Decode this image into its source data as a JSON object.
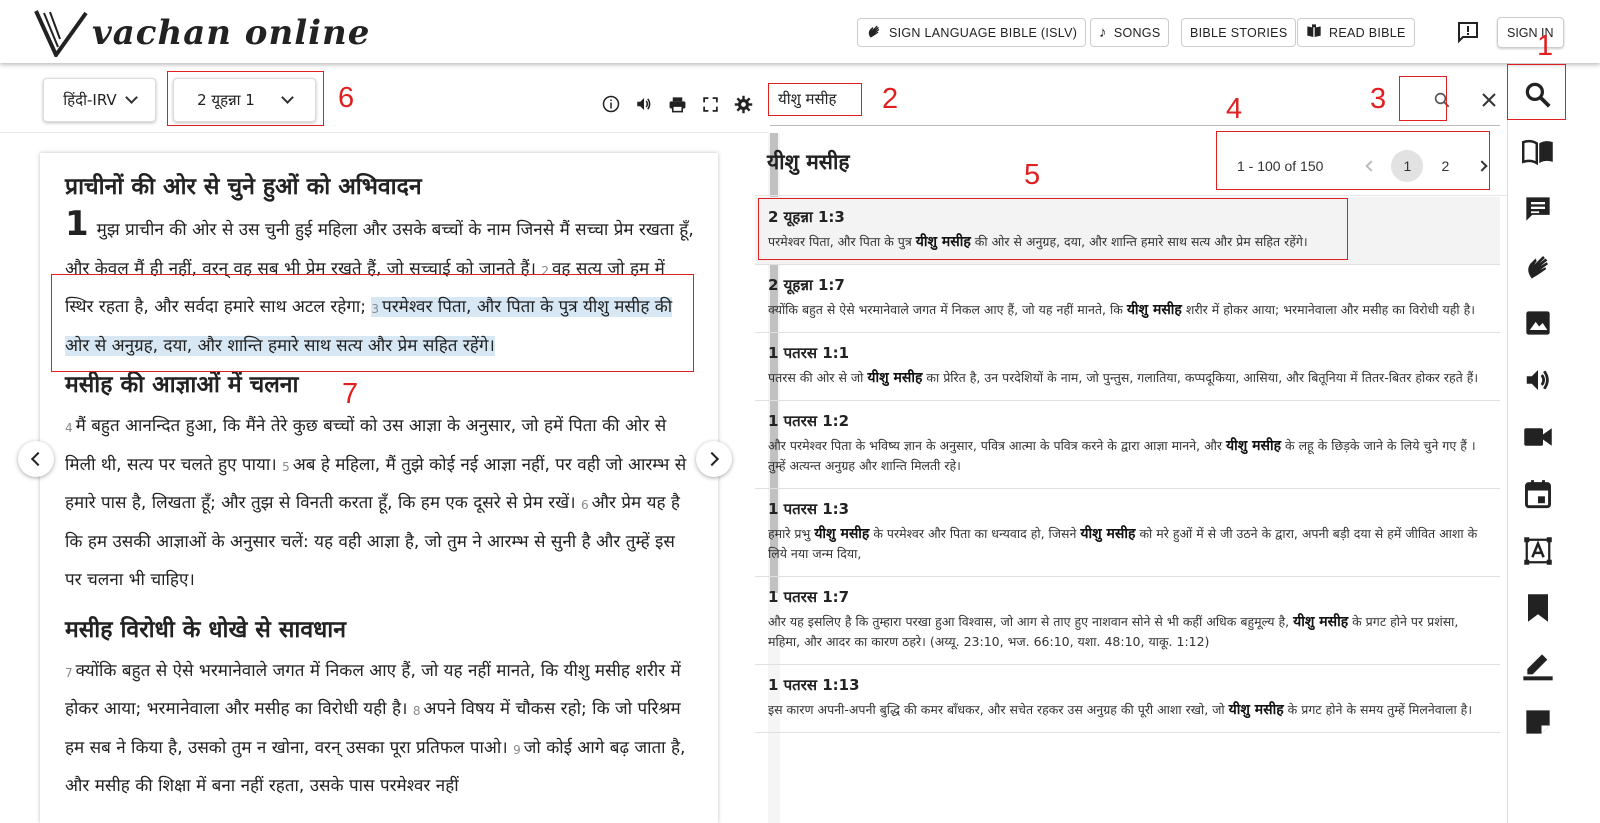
{
  "header": {
    "logo_text": "vachan online",
    "buttons": [
      {
        "label": "SIGN LANGUAGE BIBLE (ISLV)",
        "icon": "sign-language-icon"
      },
      {
        "label": "SONGS",
        "icon": "music-note-icon"
      },
      {
        "label": "BIBLE STORIES"
      },
      {
        "label": "READ BIBLE",
        "icon": "book-open-icon"
      }
    ],
    "feedback_icon": "feedback-icon",
    "sign_in": "SIGN IN"
  },
  "annotations": [
    "1",
    "2",
    "3",
    "4",
    "5",
    "6",
    "7"
  ],
  "reader": {
    "version": "हिंदी-IRV",
    "book_chapter": "2 यूहन्ना 1",
    "tool_icons": [
      "info-icon",
      "volume-icon",
      "print-icon",
      "fullscreen-icon",
      "settings-icon"
    ],
    "sections": [
      {
        "heading": "प्राचीनों की ओर से चुने हुओं को अभिवादन",
        "chapter": "1",
        "v1": "मुझ प्राचीन की ओर से उस चुनी हुई महिला और उसके बच्चों के नाम जिनसे मैं सच्चा प्रेम रखता हूँ, और केवल मैं ही नहीं, वरन् वह सब भी प्रेम रखते हैं, जो सच्चाई को जानते हैं।",
        "n2": "2",
        "v2": "वह सत्य जो हम में स्थिर रहता है, और सर्वदा हमारे साथ अटल रहेगा;",
        "n3": "3",
        "v3": "परमेश्वर पिता, और पिता के पुत्र यीशु मसीह की ओर से अनुग्रह, दया, और शान्ति हमारे साथ सत्य और प्रेम सहित रहेंगे।"
      },
      {
        "heading": "मसीह की आज्ञाओं में चलना",
        "n4": "4",
        "v4": "मैं बहुत आनन्दित हुआ, कि मैंने तेरे कुछ बच्चों को उस आज्ञा के अनुसार, जो हमें पिता की ओर से मिली थी, सत्य पर चलते हुए पाया।",
        "n5": "5",
        "v5": "अब हे महिला, मैं तुझे कोई नई आज्ञा नहीं, पर वही जो आरम्भ से हमारे पास है, लिखता हूँ; और तुझ से विनती करता हूँ, कि हम एक दूसरे से प्रेम रखें।",
        "n6": "6",
        "v6": "और प्रेम यह है कि हम उसकी आज्ञाओं के अनुसार चलें: यह वही आज्ञा है, जो तुम ने आरम्भ से सुनी है और तुम्हें इस पर चलना भी चाहिए।"
      },
      {
        "heading": "मसीह विरोधी के धोखे से सावधान",
        "n7": "7",
        "v7": "क्योंकि बहुत से ऐसे भरमानेवाले जगत में निकल आए हैं, जो यह नहीं मानते, कि यीशु मसीह शरीर में होकर आया; भरमानेवाला और मसीह का विरोधी यही है।",
        "n8": "8",
        "v8": "अपने विषय में चौकस रहो; कि जो परिश्रम हम सब ने किया है, उसको तुम न खोना, वरन् उसका पूरा प्रतिफल पाओ।",
        "n9": "9",
        "v9": "जो कोई आगे बढ़ जाता है, और मसीह की शिक्षा में बना नहीं रहता, उसके पास परमेश्वर नहीं"
      }
    ]
  },
  "search": {
    "query": "यीशु मसीह",
    "result_title": "यीशु मसीह",
    "range": "1 - 100 of 150",
    "pages": [
      "1",
      "2"
    ],
    "results": [
      {
        "ref": "2 यूहन्ना 1:3",
        "pre": "परमेश्वर पिता, और पिता के पुत्र ",
        "hit": "यीशु मसीह",
        "post": " की ओर से अनुग्रह, दया, और शान्ति हमारे साथ सत्य और प्रेम सहित रहेंगे।",
        "hit2": "",
        "post2": ""
      },
      {
        "ref": "2 यूहन्ना 1:7",
        "pre": "क्योंकि बहुत से ऐसे भरमानेवाले जगत में निकल आए हैं, जो यह नहीं मानते, कि ",
        "hit": "यीशु मसीह",
        "post": " शरीर में होकर आया; भरमानेवाला और मसीह का विरोधी यही है।",
        "hit2": "",
        "post2": ""
      },
      {
        "ref": "1 पतरस 1:1",
        "pre": "पतरस की ओर से जो ",
        "hit": "यीशु मसीह",
        "post": " का प्रेरित है, उन परदेशियों के नाम, जो पुन्तुस, गलातिया, कप्पदूकिया, आसिया, और बितूनिया में तितर-बितर होकर रहते हैं।",
        "hit2": "",
        "post2": ""
      },
      {
        "ref": "1 पतरस 1:2",
        "pre": "और परमेश्वर पिता के भविष्य ज्ञान के अनुसार, पवित्र आत्मा के पवित्र करने के द्वारा आज्ञा मानने, और ",
        "hit": "यीशु मसीह",
        "post": " के लहू के छिड़के जाने के लिये चुने गए हैं । तुम्हें अत्यन्त अनुग्रह और शान्ति मिलती रहे।",
        "hit2": "",
        "post2": ""
      },
      {
        "ref": "1 पतरस 1:3",
        "pre": "हमारे प्रभु ",
        "hit": "यीशु मसीह",
        "post": " के परमेश्वर और पिता का धन्यवाद हो, जिसने ",
        "hit2": "यीशु मसीह",
        "post2": " को मरे हुओं में से जी उठने के द्वारा, अपनी बड़ी दया से हमें जीवित आशा के लिये नया जन्म दिया,"
      },
      {
        "ref": "1 पतरस 1:7",
        "pre": "और यह इसलिए है कि तुम्हारा परखा हुआ विश्वास, जो आग से ताए हुए नाशवान सोने से भी कहीं अधिक बहुमूल्य है, ",
        "hit": "यीशु मसीह",
        "post": " के प्रगट होने पर प्रशंसा, महिमा, और आदर का कारण ठहरे। (अय्यू. 23:10, भज. 66:10, यशा. 48:10, याकू. 1:12)",
        "hit2": "",
        "post2": ""
      },
      {
        "ref": "1 पतरस 1:13",
        "pre": "इस कारण अपनी-अपनी बुद्धि की कमर बाँधकर, और सचेत रहकर उस अनुग्रह की पूरी आशा रखो, जो ",
        "hit": "यीशु मसीह",
        "post": " के प्रगट होने के समय तुम्हें मिलनेवाला है।",
        "hit2": "",
        "post2": ""
      }
    ]
  },
  "rail": [
    "search-icon",
    "book-icon",
    "comment-icon",
    "sign-language-icon",
    "image-icon",
    "audio-icon",
    "video-icon",
    "calendar-icon",
    "dictionary-icon",
    "bookmark-icon",
    "highlight-icon",
    "note-icon"
  ]
}
